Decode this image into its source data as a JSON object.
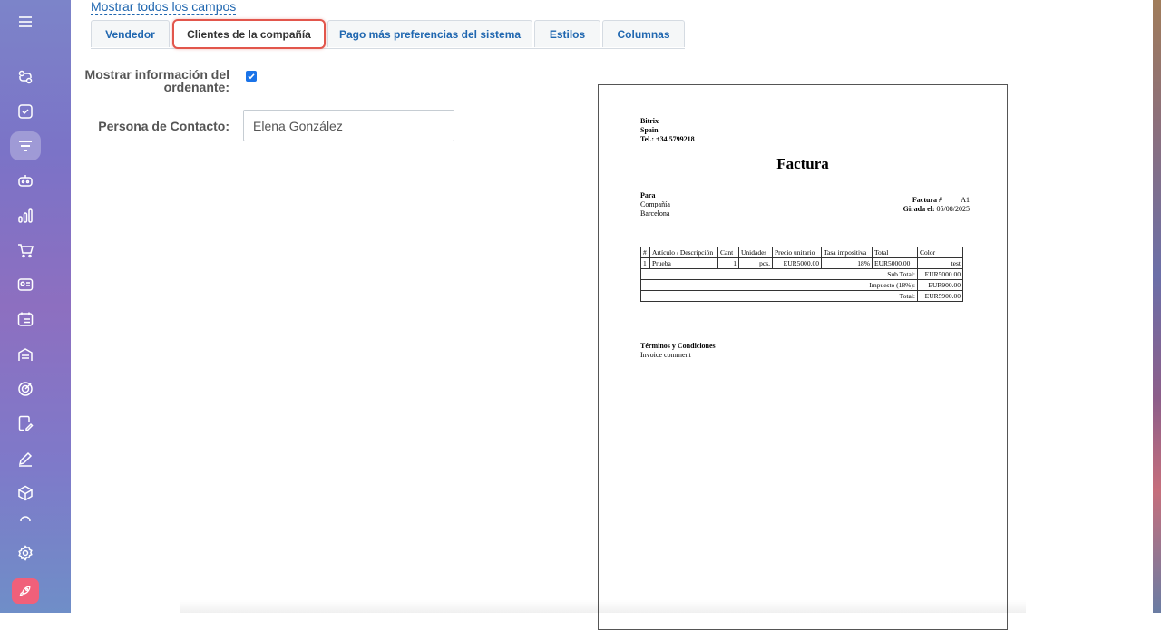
{
  "sidebar": {
    "items": [
      {
        "icon": "menu-icon"
      },
      {
        "icon": "pipeline-icon"
      },
      {
        "icon": "tasks-icon"
      },
      {
        "icon": "crm-funnel-icon",
        "active": true
      },
      {
        "icon": "robot-icon"
      },
      {
        "icon": "analytics-icon"
      },
      {
        "icon": "cart-icon"
      },
      {
        "icon": "contact-card-icon"
      },
      {
        "icon": "calendar-list-icon"
      },
      {
        "icon": "warehouse-icon"
      },
      {
        "icon": "target-icon"
      },
      {
        "icon": "signed-document-icon"
      },
      {
        "icon": "edit-pen-icon"
      },
      {
        "icon": "box-icon"
      },
      {
        "icon": "settings-icon"
      },
      {
        "icon": "rocket-icon"
      }
    ]
  },
  "show_all_link": "Mostrar todos los campos",
  "tabs": [
    {
      "label": "Vendedor"
    },
    {
      "label": "Clientes de la compañía",
      "active": true
    },
    {
      "label": "Pago más preferencias del sistema"
    },
    {
      "label": "Estilos"
    },
    {
      "label": "Columnas"
    }
  ],
  "form": {
    "show_orderer_label_line1": "Mostrar información del",
    "show_orderer_label_line2": "ordenante:",
    "show_orderer_checked": true,
    "contact_label": "Persona de Contacto:",
    "contact_value": "Elena González"
  },
  "invoice": {
    "company": "Bitrix",
    "country": "Spain",
    "phone": "Tel.: +34 5799218",
    "title": "Factura",
    "to_label": "Para",
    "to_company": "Compañía",
    "to_city": "Barcelona",
    "number_label": "Factura #",
    "number_value": "A1",
    "date_label": "Girada el:",
    "date_value": "05/08/2025",
    "columns": [
      "#",
      "Artículo / Descripción",
      "Cant",
      "Unidades",
      "Precio unitario",
      "Tasa impositiva",
      "Total",
      "Color"
    ],
    "rows": [
      {
        "num": "1",
        "item": "Prueba",
        "qty": "1",
        "unit": "pcs.",
        "price": "EUR5000.00",
        "tax": "18%",
        "total": "EUR5000.00",
        "color": "test"
      }
    ],
    "subtotal_label": "Sub Total:",
    "subtotal_value": "EUR5000.00",
    "tax_label": "Impuesto (18%):",
    "tax_value": "EUR900.00",
    "total_label": "Total:",
    "total_value": "EUR5900.00",
    "terms_title": "Términos y Condiciones",
    "terms_text": "Invoice comment"
  }
}
